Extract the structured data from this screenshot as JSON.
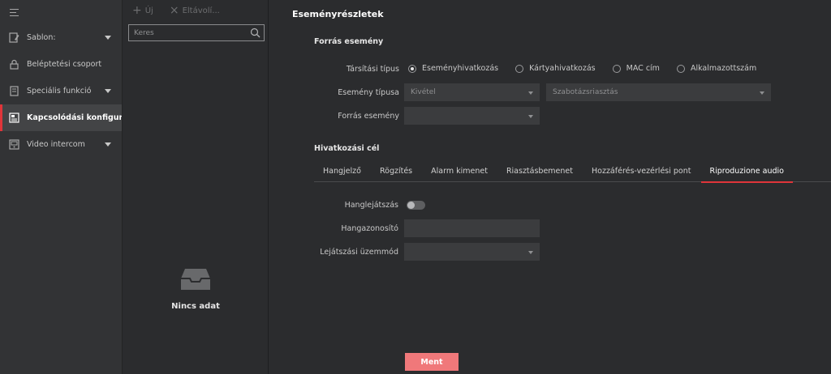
{
  "nav": {
    "items": [
      {
        "label": "Sablon:",
        "icon": "template-icon",
        "has_caret": true,
        "active": false
      },
      {
        "label": "Beléptetési csoport",
        "icon": "lock-icon",
        "has_caret": false,
        "active": false
      },
      {
        "label": "Speciális funkció",
        "icon": "special-function-icon",
        "has_caret": true,
        "active": false
      },
      {
        "label": "Kapcsolódási konfigur...",
        "icon": "linkage-config-icon",
        "has_caret": false,
        "active": true
      },
      {
        "label": "Video intercom",
        "icon": "intercom-icon",
        "has_caret": true,
        "active": false
      }
    ]
  },
  "list_panel": {
    "add_label": "Új",
    "delete_label": "Eltávolí...",
    "search_placeholder": "Keres",
    "empty_text": "Nincs adat"
  },
  "main": {
    "title": "Eseményrészletek",
    "source_section": "Forrás esemény",
    "link_type_label": "Társítási típus",
    "link_type_options": [
      "Eseményhivatkozás",
      "Kártyahivatkozás",
      "MAC cím",
      "Alkalmazottszám"
    ],
    "link_type_selected": "Eseményhivatkozás",
    "event_type_label": "Esemény típusa",
    "event_type_value": "Kivétel",
    "event_subtype_value": "Szabotázsriasztás",
    "event_source_label": "Forrás esemény",
    "event_source_value": "",
    "target_section": "Hivatkozási cél",
    "tabs": [
      "Hangjelző",
      "Rögzítés",
      "Alarm kimenet",
      "Riasztásbemenet",
      "Hozzáférés-vezérlési pont",
      "Riproduzione audio"
    ],
    "active_tab": "Riproduzione audio",
    "audio_play_label": "Hanglejátszás",
    "audio_play_enabled": false,
    "audio_id_label": "Hangazonosító",
    "audio_id_value": "",
    "play_mode_label": "Lejátszási üzemmód",
    "play_mode_value": "",
    "save_label": "Ment"
  },
  "colors": {
    "accent": "#e0353a",
    "save_button": "#f0787a",
    "background": "#2b2c2e",
    "nav_background": "#323335"
  }
}
